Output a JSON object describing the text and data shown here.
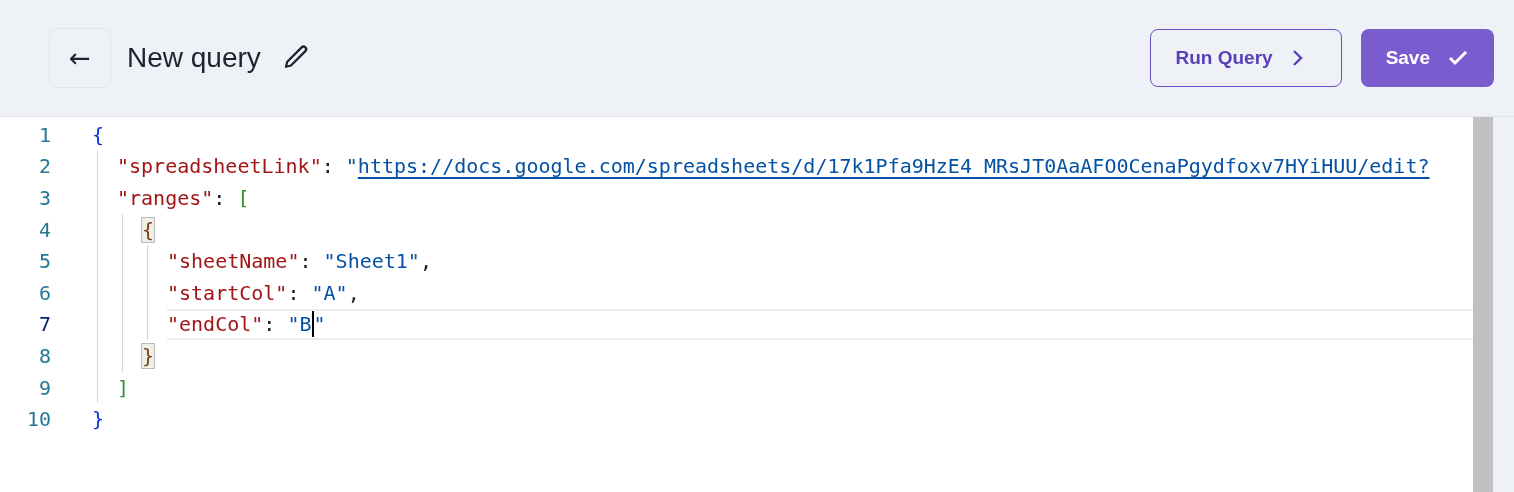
{
  "header": {
    "back_button": "←",
    "title": "New query",
    "buttons": [
      {
        "kind": "outline",
        "label": "Run Query"
      },
      {
        "kind": "primary",
        "label": "Save"
      }
    ]
  },
  "editor": {
    "lines": [
      {
        "number": "1",
        "current": false,
        "tokens": [
          {
            "kind": "bracket",
            "text": "{",
            "matched": false
          }
        ],
        "children": [
          {
            "number": "2",
            "current": false,
            "tokens": [
              {
                "kind": "key",
                "text": "\"spreadsheetLink\""
              },
              {
                "kind": "punct",
                "text": ": "
              },
              {
                "kind": "string",
                "text": "\""
              },
              {
                "kind": "link",
                "text": "https://docs.google.com/spreadsheets/d/17k1Pfa9HzE4_MRsJT0AaAFO0CenaPgydfoxv7HYiHUU/edit?"
              }
            ]
          },
          {
            "number": "3",
            "current": false,
            "tokens": [
              {
                "kind": "key",
                "text": "\"ranges\""
              },
              {
                "kind": "punct",
                "text": ": "
              },
              {
                "kind": "bracket",
                "text": "[",
                "matched": false
              }
            ],
            "children": [
              {
                "number": "4",
                "current": false,
                "tokens": [
                  {
                    "kind": "bracket",
                    "text": "{",
                    "matched": true
                  }
                ],
                "children": [
                  {
                    "number": "5",
                    "current": false,
                    "tokens": [
                      {
                        "kind": "key",
                        "text": "\"sheetName\""
                      },
                      {
                        "kind": "punct",
                        "text": ": "
                      },
                      {
                        "kind": "string",
                        "text": "\"Sheet1\""
                      },
                      {
                        "kind": "punct",
                        "text": ","
                      }
                    ]
                  },
                  {
                    "number": "6",
                    "current": false,
                    "tokens": [
                      {
                        "kind": "key",
                        "text": "\"startCol\""
                      },
                      {
                        "kind": "punct",
                        "text": ": "
                      },
                      {
                        "kind": "string",
                        "text": "\"A\""
                      },
                      {
                        "kind": "punct",
                        "text": ","
                      }
                    ]
                  },
                  {
                    "number": "7",
                    "current": true,
                    "tokens": [
                      {
                        "kind": "key",
                        "text": "\"endCol\""
                      },
                      {
                        "kind": "punct",
                        "text": ": "
                      },
                      {
                        "kind": "string",
                        "text": "\"B"
                      },
                      {
                        "kind": "cursor"
                      },
                      {
                        "kind": "string",
                        "text": "\""
                      }
                    ]
                  }
                ]
              },
              {
                "number": "8",
                "current": false,
                "tokens": [
                  {
                    "kind": "bracket",
                    "text": "}",
                    "matched": true
                  }
                ]
              }
            ]
          },
          {
            "number": "9",
            "current": false,
            "tokens": [
              {
                "kind": "bracket",
                "text": "]",
                "matched": false
              }
            ]
          }
        ]
      },
      {
        "number": "10",
        "current": false,
        "tokens": [
          {
            "kind": "bracket",
            "text": "}",
            "matched": false
          }
        ]
      }
    ]
  }
}
